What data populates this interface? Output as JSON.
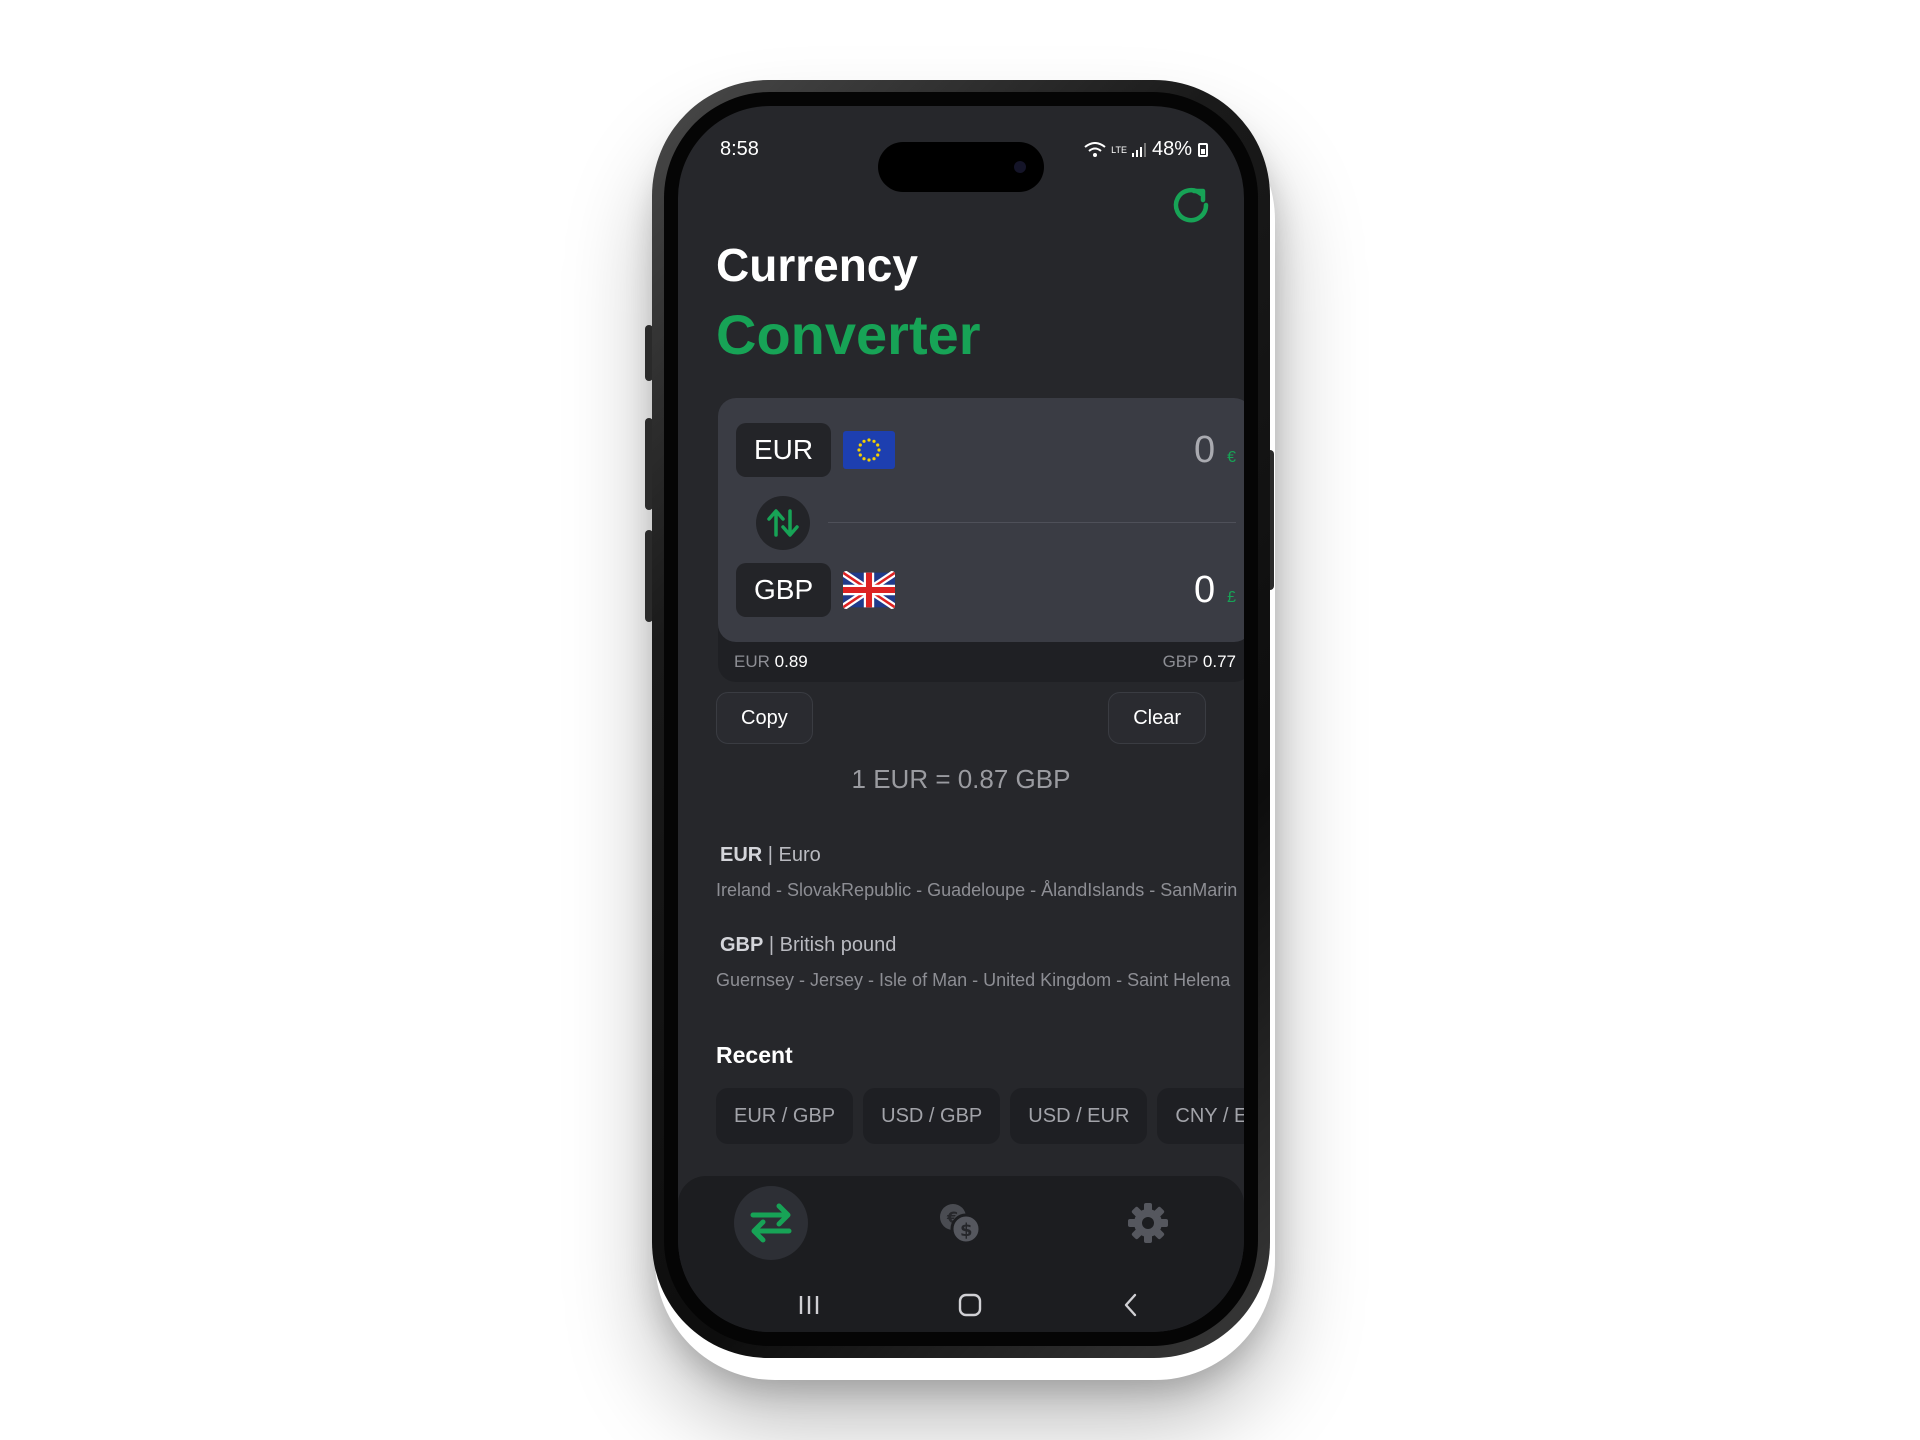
{
  "status_bar": {
    "time": "8:58",
    "battery": "48%",
    "network": "LTE"
  },
  "header": {
    "title_line1": "Currency",
    "title_line2": "Converter"
  },
  "converter": {
    "from": {
      "code": "EUR",
      "amount": "0",
      "symbol": "€",
      "flag": "eu-flag"
    },
    "to": {
      "code": "GBP",
      "amount": "0",
      "symbol": "£",
      "flag": "uk-flag"
    },
    "from_rate": {
      "code": "EUR",
      "value": "0.89"
    },
    "to_rate": {
      "code": "GBP",
      "value": "0.77"
    }
  },
  "actions": {
    "copy_label": "Copy",
    "clear_label": "Clear"
  },
  "exchange_rate": "1 EUR = 0.87 GBP",
  "currency_info": [
    {
      "code": "EUR",
      "name": "| Euro",
      "countries": "Ireland - SlovakRepublic - Guadeloupe - ÅlandIslands - SanMarino"
    },
    {
      "code": "GBP",
      "name": "| British pound",
      "countries": "Guernsey - Jersey - Isle of Man - United Kingdom - Saint Helena"
    }
  ],
  "recent": {
    "title": "Recent",
    "pairs": [
      "EUR / GBP",
      "USD / GBP",
      "USD / EUR",
      "CNY / EUR"
    ]
  },
  "tabs": [
    {
      "name": "convert",
      "icon": "swap-arrows-icon",
      "active": true
    },
    {
      "name": "currencies",
      "icon": "coins-icon",
      "active": false
    },
    {
      "name": "settings",
      "icon": "gear-icon",
      "active": false
    }
  ],
  "colors": {
    "accent": "#17a356",
    "background": "#26272b",
    "card": "#3a3c44"
  }
}
